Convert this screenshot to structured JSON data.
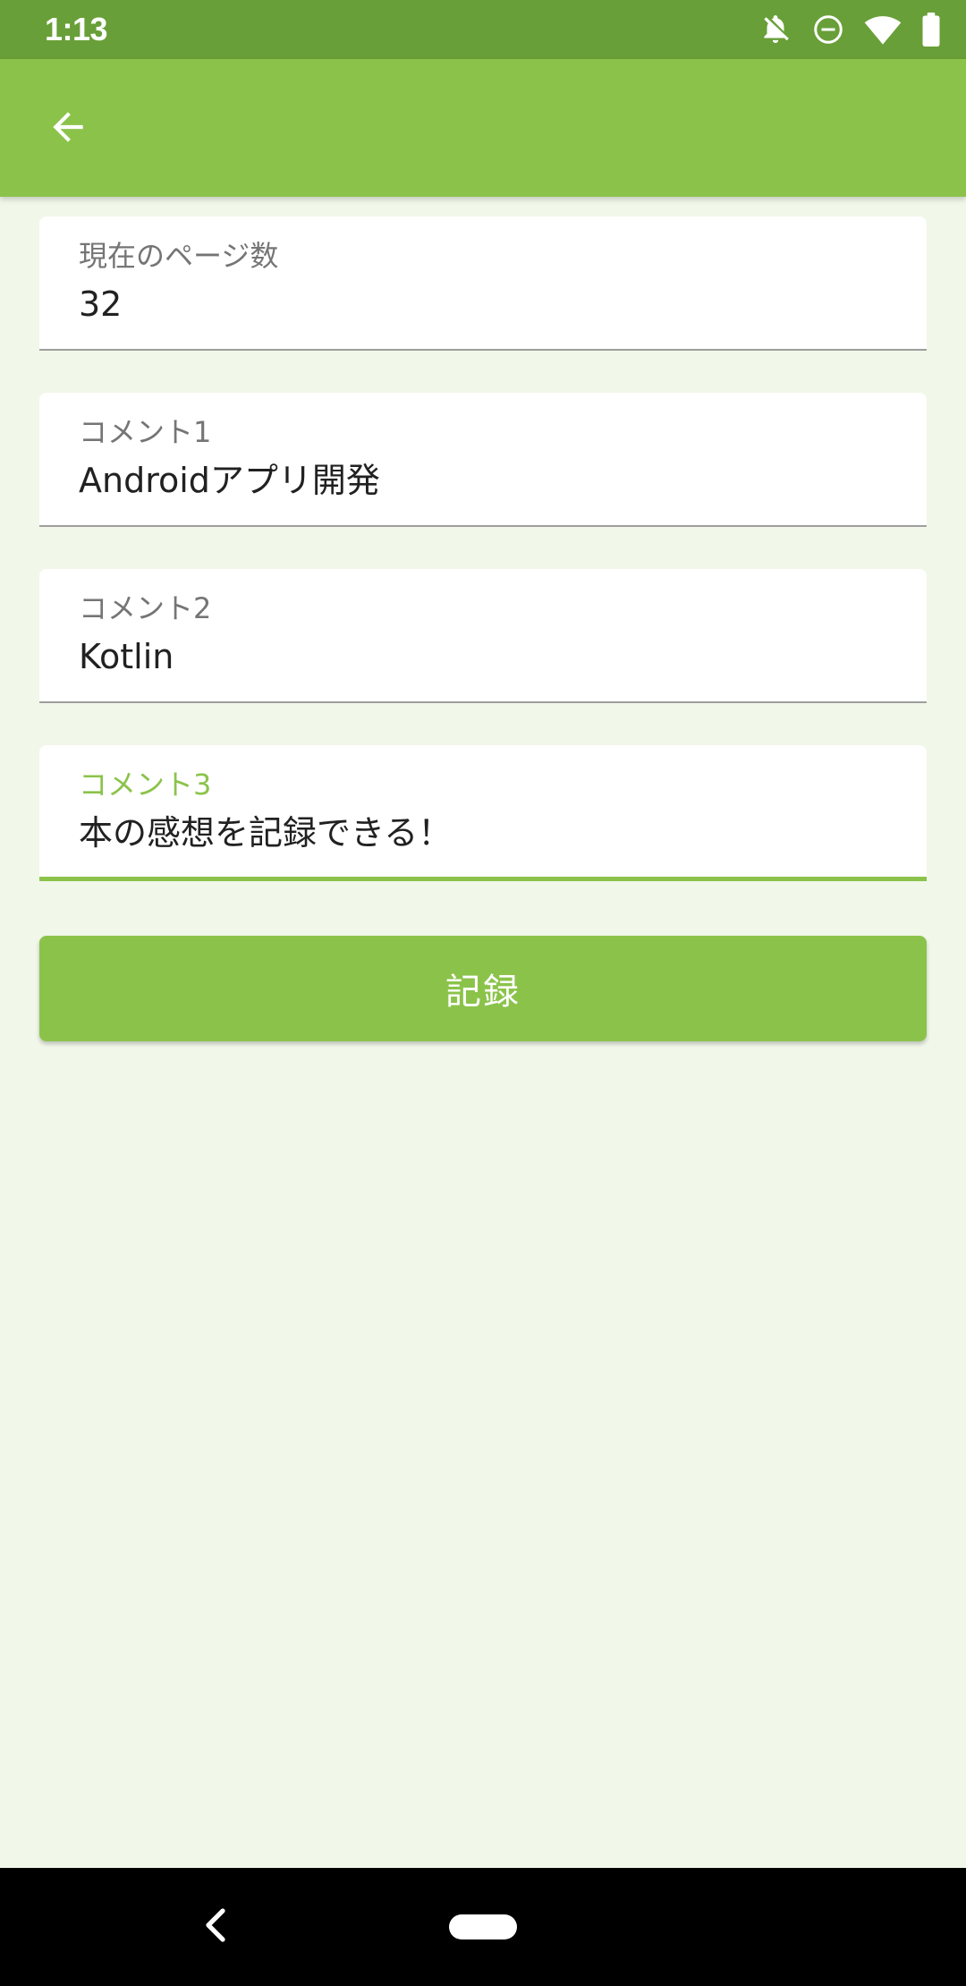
{
  "status_bar": {
    "time": "1:13",
    "icons": [
      "notifications-off-icon",
      "do-not-disturb-icon",
      "wifi-icon",
      "battery-icon"
    ]
  },
  "app_bar": {
    "back_icon": "arrow-back-icon"
  },
  "form": {
    "fields": [
      {
        "label": "現在のページ数",
        "value": "32"
      },
      {
        "label": "コメント1",
        "value": "Androidアプリ開発"
      },
      {
        "label": "コメント2",
        "value": "Kotlin"
      },
      {
        "label": "コメント3",
        "value": "本の感想を記録できる！"
      }
    ],
    "submit_label": "記録"
  },
  "navigation_bar": {
    "icons": [
      "nav-back-icon",
      "nav-home-pill"
    ]
  },
  "colors": {
    "status_bar": "#689F38",
    "primary": "#8BC34A",
    "background": "#F1F7E9",
    "label_inactive": "#757575",
    "text": "#212121"
  }
}
